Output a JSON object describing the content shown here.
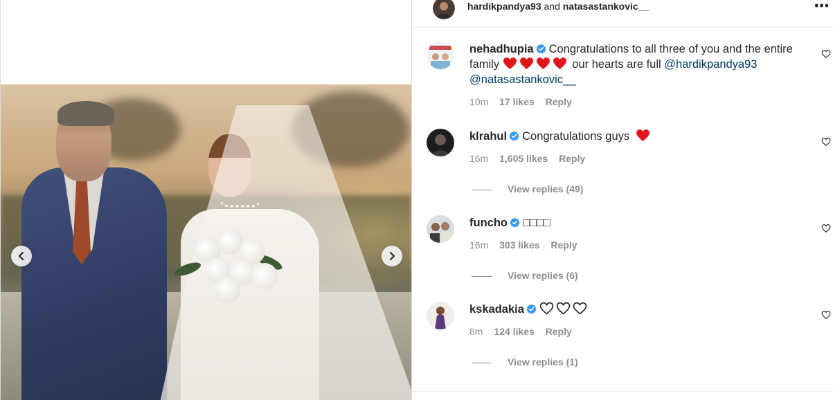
{
  "post": {
    "header_user_1": "hardikpandya93",
    "header_and": "and",
    "header_user_2": "natasastankovic__",
    "more_label": "•••"
  },
  "colors": {
    "verified": "#3897f0",
    "mention": "#00376b",
    "red_heart": "#e0161b",
    "meta_gray": "#8e8e8e"
  },
  "comments": [
    {
      "username": "nehadhupia",
      "text_before": "Congratulations to all three of you and the entire family",
      "emoji": "red-heart x4",
      "text_after": "our hearts are full",
      "mention_1": "@hardikpandya93",
      "mention_2": "@natasastankovic__",
      "time": "10m",
      "likes": "17 likes",
      "reply": "Reply"
    },
    {
      "username": "klrahul",
      "text": "Congratulations guys",
      "emoji": "red-heart",
      "time": "16m",
      "likes": "1,605 likes",
      "reply": "Reply",
      "view_replies": "View replies (49)"
    },
    {
      "username": "funcho",
      "text": "□□□□",
      "time": "16m",
      "likes": "303 likes",
      "reply": "Reply",
      "view_replies": "View replies (6)"
    },
    {
      "username": "kskadakia",
      "emoji": "outline-heart x3",
      "time": "8m",
      "likes": "124 likes",
      "reply": "Reply",
      "view_replies": "View replies (1)"
    }
  ]
}
